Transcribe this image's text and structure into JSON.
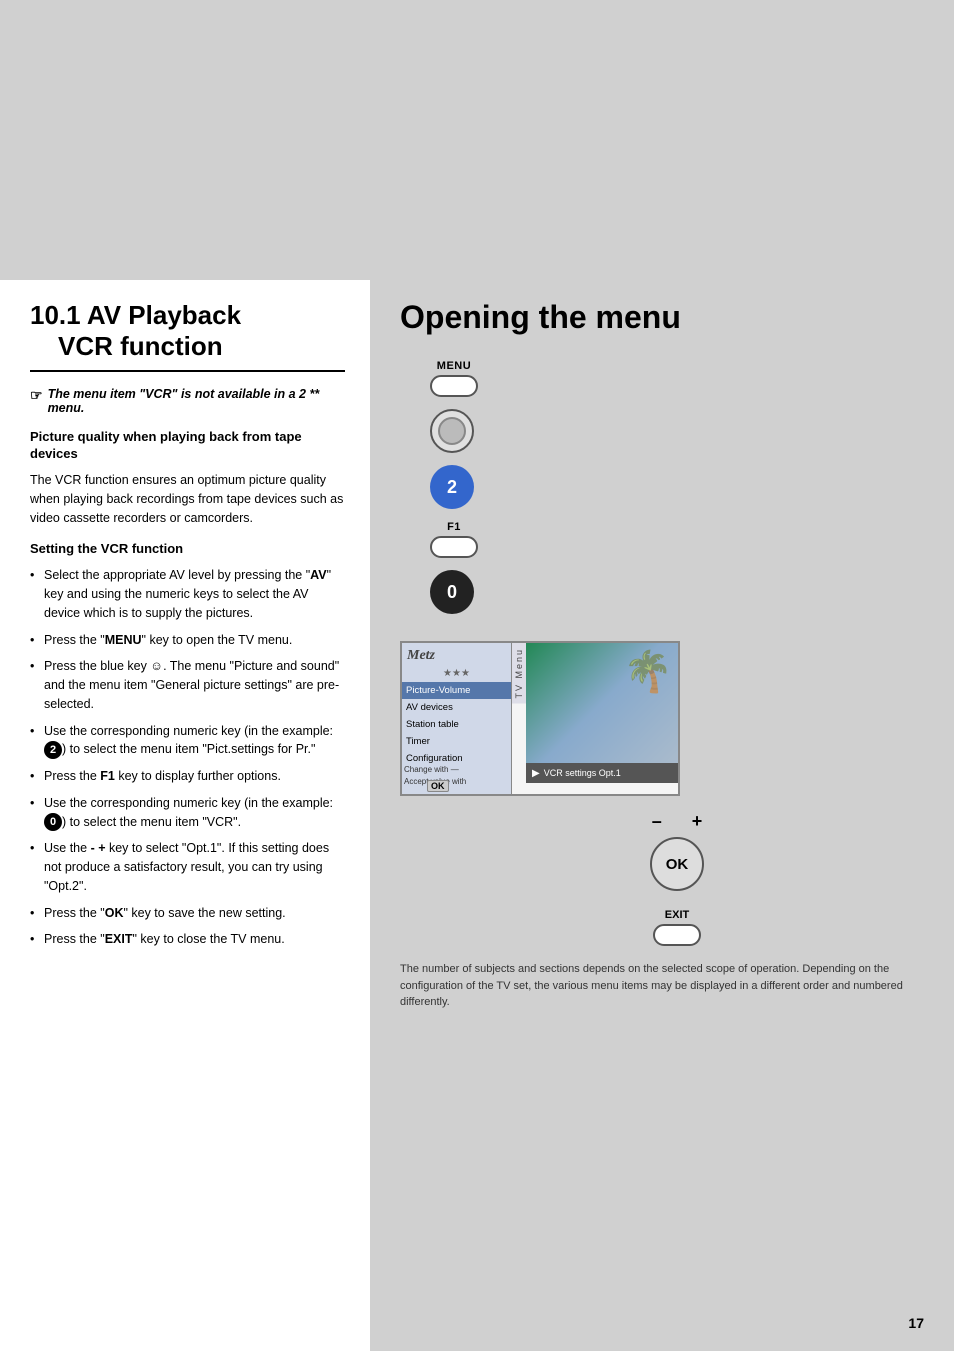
{
  "page": {
    "background_top": "#d0d0d0",
    "background_right": "#d0d0d0"
  },
  "left_column": {
    "section_number": "10.1",
    "section_title_line1": "AV Playback",
    "section_title_line2": "VCR function",
    "note": "The menu item \"VCR\" is not available in a 2 ** menu.",
    "sub_heading_1": "Picture quality when playing back from tape devices",
    "body_text_1": "The VCR function ensures an optimum picture quality when playing back recordings from tape devices such as video cassette recorders or camcorders.",
    "sub_heading_2": "Setting the VCR function",
    "bullets": [
      "Select the appropriate AV level by pressing the \"AV\" key and using the numeric keys to select the AV device which is to supply the pictures.",
      "Press the \"MENU\" key to open the TV menu.",
      "Press the blue key ☺. The menu \"Picture and sound\" and the menu item \"General picture settings\" are pre-selected.",
      "Use the corresponding numeric key (in the example: ❷) to select the menu item \"Pict.settings for Pr.\"",
      "Press the F1 key to display further options.",
      "Use the corresponding numeric key (in the example: ❶) to select the menu item \"VCR\".",
      "Use the - + key to select \"Opt.1\". If this setting does not produce a satisfactory result, you can try using \"Opt.2\".",
      "Press the \"OK\" key to save the new setting.",
      "Press the \"EXIT\" key to close the TV menu."
    ]
  },
  "right_column": {
    "title": "Opening the menu",
    "remote_buttons": [
      {
        "label": "MENU",
        "type": "oval"
      },
      {
        "label": "",
        "type": "circle_ring"
      },
      {
        "label": "2",
        "type": "circle_blue"
      },
      {
        "label": "F1",
        "type": "oval"
      },
      {
        "label": "0",
        "type": "circle_black"
      }
    ],
    "tv_menu": {
      "logo": "Metz",
      "stars": "★★★",
      "menu_vertical_label": "TV Menu",
      "items": [
        {
          "label": "Picture-Volume",
          "selected": true
        },
        {
          "label": "AV devices",
          "selected": false
        },
        {
          "label": "Station table",
          "selected": false
        },
        {
          "label": "Timer",
          "selected": false
        },
        {
          "label": "Configuration",
          "selected": false
        }
      ],
      "bottom_bar1": "Change with —",
      "bottom_bar2": "Accept value with",
      "ok_label": "OK",
      "vcr_text": "▶VCR settings    Opt.1"
    },
    "ok_button": "OK",
    "exit_button_label": "EXIT",
    "footer_note": "The number of subjects and sections depends on the selected scope of operation. Depending on the configuration of the TV set, the various menu items may be displayed in a different order and numbered differently."
  },
  "page_number": "17"
}
